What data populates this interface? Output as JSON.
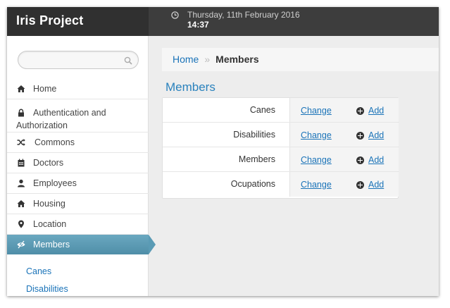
{
  "header": {
    "brand": "Iris Project",
    "date": "Thursday, 11th February 2016",
    "time": "14:37"
  },
  "search": {
    "placeholder": "",
    "value": ""
  },
  "sidebar": {
    "items": [
      {
        "label": "Home",
        "icon": "home-icon"
      },
      {
        "label": "Authentication and Authorization",
        "icon": "lock-icon"
      },
      {
        "label": "Commons",
        "icon": "shuffle-icon"
      },
      {
        "label": "Doctors",
        "icon": "calendar-icon"
      },
      {
        "label": "Employees",
        "icon": "user-icon"
      },
      {
        "label": "Housing",
        "icon": "home-icon"
      },
      {
        "label": "Location",
        "icon": "map-marker-icon"
      },
      {
        "label": "Members",
        "icon": "eye-slash-icon",
        "active": true
      }
    ],
    "subitems": [
      {
        "label": "Canes"
      },
      {
        "label": "Disabilities"
      }
    ]
  },
  "breadcrumb": {
    "home": "Home",
    "separator": "»",
    "current": "Members"
  },
  "page": {
    "title": "Members"
  },
  "models": [
    {
      "name": "Canes",
      "change": "Change",
      "add": "Add"
    },
    {
      "name": "Disabilities",
      "change": "Change",
      "add": "Add"
    },
    {
      "name": "Members",
      "change": "Change",
      "add": "Add"
    },
    {
      "name": "Ocupations",
      "change": "Change",
      "add": "Add"
    }
  ],
  "colors": {
    "header_bg": "#3d3d3d",
    "brand_bg": "#303030",
    "active_nav": "#5a9bb5",
    "link": "#1a73b8",
    "page_title": "#2a82bd",
    "content_bg": "#ededed"
  }
}
